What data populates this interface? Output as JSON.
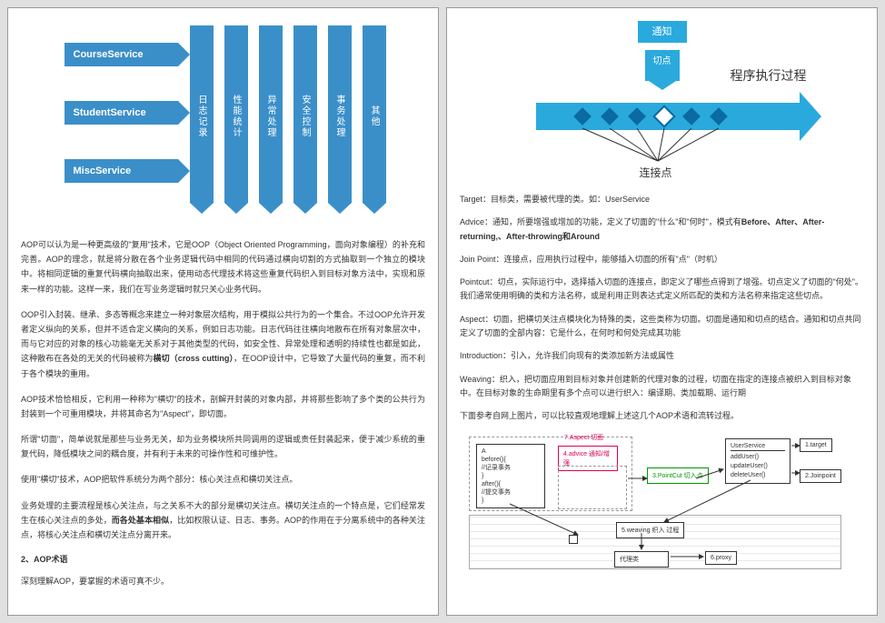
{
  "page1": {
    "hArrows": [
      "CourseService",
      "StudentService",
      "MiscService"
    ],
    "vArrows": [
      "日志记录",
      "性能统计",
      "异常处理",
      "安全控制",
      "事务处理",
      "其他"
    ],
    "p1": "AOP可以认为是一种更高级的\"复用\"技术，它是OOP（Object Oriented Programming，面向对象编程）的补充和完善。AOP的理念，就是将分散在各个业务逻辑代码中相同的代码通过横向切割的方式抽取到一个独立的模块中。将相同逻辑的重复代码横向抽取出来，使用动态代理技术将这些重复代码织入到目标对象方法中，实现和原来一样的功能。这样一来，我们在写业务逻辑时就只关心业务代码。",
    "p2_a": "OOP引入封装、继承、多态等概念来建立一种对象层次结构，用于模拟公共行为的一个集合。不过OOP允许开发者定义纵向的关系，但并不适合定义横向的关系，例如日志功能。日志代码往往横向地散布在所有对象层次中，而与它对应的对象的核心功能毫无关系对于其他类型的代码，如安全性、异常处理和透明的持续性也都是如此，这种散布在各处的无关的代码被称为",
    "p2_bold": "横切（cross cutting）",
    "p2_b": "，在OOP设计中，它导致了大量代码的重复，而不利于各个模块的重用。",
    "p3": "AOP技术恰恰相反，它利用一种称为\"横切\"的技术，剖解开封装的对象内部，并将那些影响了多个类的公共行为封装到一个可重用模块，并将其命名为\"Aspect\"，即切面。",
    "p4": "所谓\"切面\"，简单说就是那些与业务无关，却为业务模块所共同调用的逻辑或责任封装起来，便于减少系统的重复代码，降低模块之间的耦合度，并有利于未来的可操作性和可维护性。",
    "p5": "使用\"横切\"技术，AOP把软件系统分为两个部分：核心关注点和横切关注点。",
    "p6_a": "业务处理的主要流程是核心关注点，与之关系不大的部分是横切关注点。横切关注点的一个特点是，它们经常发生在核心关注点的多处，",
    "p6_bold": "而各处基本相似",
    "p6_b": "，比如权限认证、日志、事务。AOP的作用在于分离系统中的各种关注点，将核心关注点和横切关注点分离开来。",
    "h3": "2、AOP术语",
    "p7": "深刻理解AOP，要掌握的术语可真不少。"
  },
  "page2": {
    "notice": "通知",
    "pointcut": "切点",
    "process": "程序执行过程",
    "joinpoint": "连接点",
    "t_target_a": "Target：目标类，需要被代理的类。如：UserService",
    "t_advice_a": "Advice：通知，所要增强或增加的功能，定义了切面的\"什么\"和\"何时\"，模式有",
    "t_advice_b": "Before、After、After-returning,、After-throwing和Around",
    "t_joinpoint": "Join Point：连接点，应用执行过程中，能够插入切面的所有\"点\"（时机）",
    "t_pointcut": "Pointcut：切点，实际运行中，选择插入切面的连接点，即定义了哪些点得到了增强。切点定义了切面的\"何处\"。我们通常使用明确的类和方法名称，或是利用正则表达式定义所匹配的类和方法名称来指定这些切点。",
    "t_aspect": "Aspect：切面，把横切关注点模块化为特殊的类，这些类称为切面。切面是通知和切点的结合。通知和切点共同定义了切面的全部内容：它是什么，在何时和何处完成其功能",
    "t_intro": "Introduction：引入，允许我们向现有的类添加新方法或属性",
    "t_weaving": "Weaving：织入，把切面应用到目标对象并创建新的代理对象的过程，切面在指定的连接点被织入到目标对象中。在目标对象的生命期里有多个点可以进行织入：编译期、类加载期、运行期",
    "ref": "下面参考自网上图片，可以比较直观地理解上述这几个AOP术语和流转过程。",
    "d3": {
      "boxA_l1": "A",
      "boxA_l2": "before(){",
      "boxA_l3": "//记录事务",
      "boxA_l4": "}",
      "boxA_l5": "after(){",
      "boxA_l6": "//提交事务",
      "boxA_l7": "}",
      "aspect": "7.Aspect 切面",
      "advice": "4.advice 通知/增强",
      "pointcut": "3.PointCut 切入点",
      "us_title": "UserService",
      "us_m1": "addUser()",
      "us_m2": "updateUser()",
      "us_m3": "deleteUser()",
      "target": "1.target",
      "joinpoint": "2.Joinpoint",
      "weaving": "5.weaving 织入 过程",
      "proxyclass": "代理类",
      "proxy": "6.proxy"
    }
  }
}
